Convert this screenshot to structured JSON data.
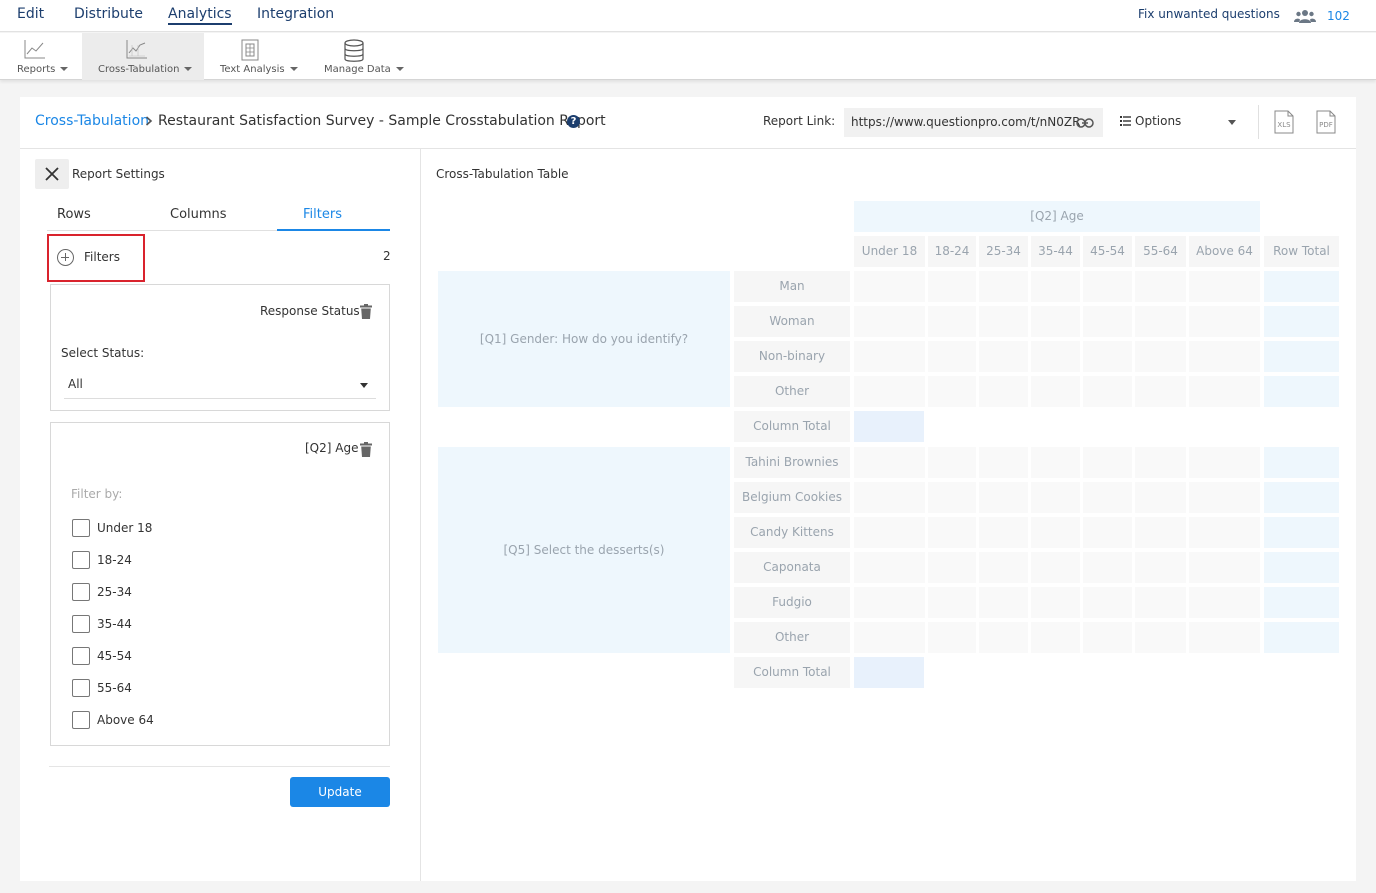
{
  "topnav": {
    "items": [
      "Edit",
      "Distribute",
      "Analytics",
      "Integration"
    ],
    "fix_link": "Fix unwanted questions",
    "user_count": "102"
  },
  "toolbar": {
    "items": [
      "Reports",
      "Cross-Tabulation",
      "Text Analysis",
      "Manage Data"
    ]
  },
  "header": {
    "breadcrumb_link": "Cross-Tabulation",
    "title": "Restaurant Satisfaction Survey - Sample Crosstabulation Report",
    "help": "?",
    "report_link_label": "Report Link:",
    "report_link_value": "https://www.questionpro.com/t/nN0ZR",
    "options_label": "Options",
    "xls_label": "XLS",
    "pdf_label": "PDF"
  },
  "sidebar": {
    "title": "Report Settings",
    "tabs": [
      "Rows",
      "Columns",
      "Filters"
    ],
    "add_filter_label": "Filters",
    "filter_count": "2",
    "response_card": {
      "title": "Response Status",
      "select_label": "Select Status:",
      "select_value": "All"
    },
    "age_card": {
      "title": "[Q2] Age",
      "filter_by": "Filter by:",
      "options": [
        "Under 18",
        "18-24",
        "25-34",
        "35-44",
        "45-54",
        "55-64",
        "Above 64"
      ]
    },
    "update_label": "Update"
  },
  "table": {
    "title": "Cross-Tabulation Table",
    "column_question": "[Q2] Age",
    "columns": [
      "Under 18",
      "18-24",
      "25-34",
      "35-44",
      "45-54",
      "55-64",
      "Above 64"
    ],
    "row_total": "Row Total",
    "groups": [
      {
        "question": "[Q1] Gender: How do you identify?",
        "rows": [
          "Man",
          "Woman",
          "Non-binary",
          "Other"
        ],
        "column_total": "Column Total"
      },
      {
        "question": "[Q5] Select the desserts(s)",
        "rows": [
          "Tahini Brownies",
          "Belgium Cookies",
          "Candy Kittens",
          "Caponata",
          "Fudgio",
          "Other"
        ],
        "column_total": "Column Total"
      }
    ]
  },
  "colors": {
    "accent": "#1b87e6",
    "nav": "#1c3e6e",
    "highlight": "#d9232d",
    "cell_header": "#eef7fd"
  }
}
